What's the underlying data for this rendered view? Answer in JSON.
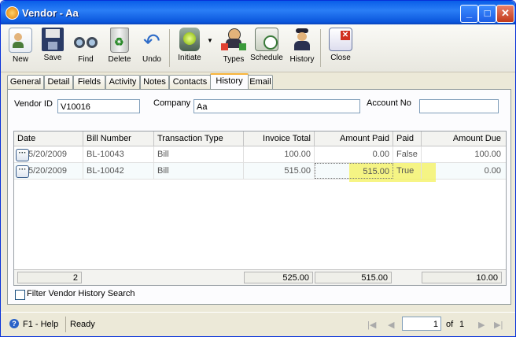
{
  "window": {
    "title": "Vendor - Aa"
  },
  "toolbar": {
    "new": "New",
    "save": "Save",
    "find": "Find",
    "delete": "Delete",
    "undo": "Undo",
    "initiate": "Initiate",
    "types": "Types",
    "schedule": "Schedule",
    "history": "History",
    "close": "Close"
  },
  "tabs": [
    "General",
    "Detail",
    "Fields",
    "Activity",
    "Notes",
    "Contacts",
    "History",
    "Email"
  ],
  "fields": {
    "vendor_id_label": "Vendor ID",
    "vendor_id_value": "V10016",
    "company_label": "Company",
    "company_value": "Aa",
    "account_no_label": "Account No",
    "account_no_value": ""
  },
  "grid": {
    "columns": [
      "Date",
      "Bill Number",
      "Transaction Type",
      "Invoice Total",
      "Amount Paid",
      "Paid",
      "Amount Due"
    ],
    "rows": [
      {
        "date": "5/20/2009",
        "bill": "BL-10043",
        "type": "Bill",
        "invoice": "100.00",
        "paid_amt": "0.00",
        "paid": "False",
        "due": "100.00"
      },
      {
        "date": "5/20/2009",
        "bill": "BL-10042",
        "type": "Bill",
        "invoice": "515.00",
        "paid_amt": "515.00",
        "paid": "True",
        "due": "0.00"
      }
    ],
    "footer": {
      "count": "2",
      "invoice": "525.00",
      "paid_amt": "515.00",
      "due": "10.00"
    }
  },
  "filter_label": "Filter Vendor History Search",
  "status": {
    "help": "F1 - Help",
    "state": "Ready",
    "page": "1",
    "of_label": "of",
    "total": "1"
  }
}
